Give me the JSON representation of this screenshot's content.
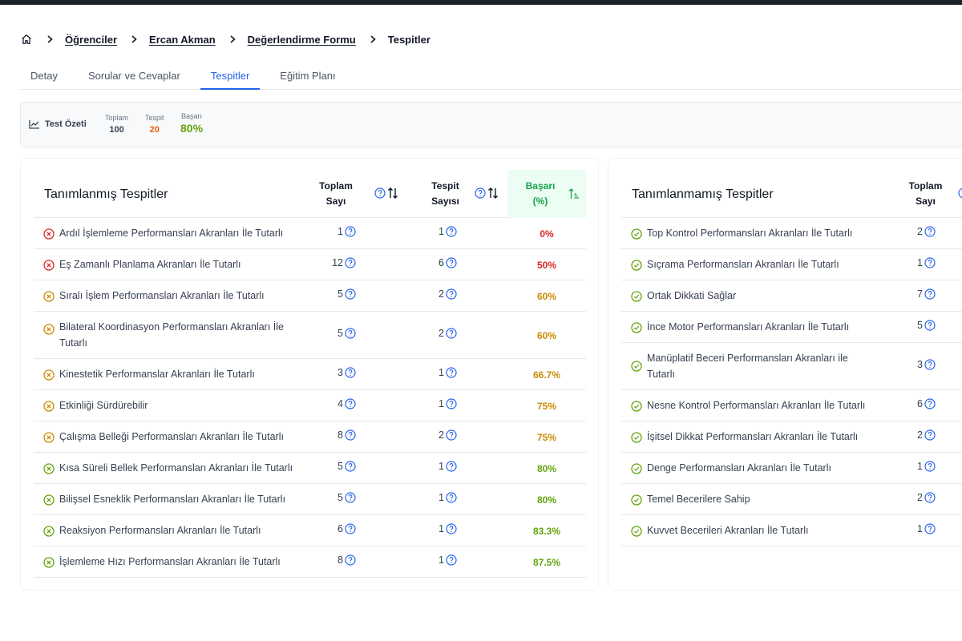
{
  "breadcrumb": {
    "items": [
      "Öğrenciler",
      "Ercan Akman",
      "Değerlendirme Formu"
    ],
    "current": "Tespitler"
  },
  "tabs": [
    {
      "label": "Detay",
      "active": false
    },
    {
      "label": "Sorular ve Cevaplar",
      "active": false
    },
    {
      "label": "Tespitler",
      "active": true
    },
    {
      "label": "Eğitim Planı",
      "active": false
    }
  ],
  "summary": {
    "title": "Test Özeti",
    "toplam_label": "Toplam",
    "toplam_value": "100",
    "tespit_label": "Tespit",
    "tespit_value": "20",
    "basari_label": "Başarı",
    "basari_value": "80%"
  },
  "defined": {
    "title": "Tanımlanmış Tespitler",
    "col_total_1": "Toplam",
    "col_total_2": "Sayı",
    "col_tespit_1": "Tespit",
    "col_tespit_2": "Sayısı",
    "col_basari_1": "Başarı",
    "col_basari_2": "(%)",
    "rows": [
      {
        "name": "Ardıl İşlemleme Performansları Akranları İle Tutarlı",
        "total": "1",
        "tespit": "1",
        "pct": "0%",
        "level": "red"
      },
      {
        "name": "Eş Zamanlı Planlama Akranları İle Tutarlı",
        "total": "12",
        "tespit": "6",
        "pct": "50%",
        "level": "red"
      },
      {
        "name": "Sıralı İşlem Performansları Akranları İle Tutarlı",
        "total": "5",
        "tespit": "2",
        "pct": "60%",
        "level": "amber"
      },
      {
        "name": "Bilateral Koordinasyon Performansları Akranları İle",
        "name2": "Tutarlı",
        "total": "5",
        "tespit": "2",
        "pct": "60%",
        "level": "amber"
      },
      {
        "name": "Kinestetik Performanslar Akranları İle Tutarlı",
        "total": "3",
        "tespit": "1",
        "pct": "66.7%",
        "level": "amber"
      },
      {
        "name": "Etkinliği Sürdürebilir",
        "total": "4",
        "tespit": "1",
        "pct": "75%",
        "level": "amber"
      },
      {
        "name": "Çalışma Belleği Performansları Akranları İle Tutarlı",
        "total": "8",
        "tespit": "2",
        "pct": "75%",
        "level": "amber"
      },
      {
        "name": "Kısa Süreli Bellek Performansları Akranları İle Tutarlı",
        "total": "5",
        "tespit": "1",
        "pct": "80%",
        "level": "green"
      },
      {
        "name": "Bilişsel Esneklik Performansları Akranları İle Tutarlı",
        "total": "5",
        "tespit": "1",
        "pct": "80%",
        "level": "green"
      },
      {
        "name": "Reaksiyon Performansları Akranları İle Tutarlı",
        "total": "6",
        "tespit": "1",
        "pct": "83.3%",
        "level": "green"
      },
      {
        "name": "İşlemleme Hızı Performansları Akranları İle Tutarlı",
        "total": "8",
        "tespit": "1",
        "pct": "87.5%",
        "level": "green"
      }
    ]
  },
  "undefined": {
    "title": "Tanımlanmamış Tespitler",
    "col_total_1": "Toplam",
    "col_total_2": "Sayı",
    "rows": [
      {
        "name": "Top Kontrol Performansları Akranları İle Tutarlı",
        "total": "2"
      },
      {
        "name": "Sıçrama Performansları Akranları İle Tutarlı",
        "total": "1"
      },
      {
        "name": "Ortak Dikkati Sağlar",
        "total": "7"
      },
      {
        "name": "İnce Motor Performansları Akranları İle Tutarlı",
        "total": "5"
      },
      {
        "name": "Manüplatif Beceri Performansları Akranları ile",
        "name2": "Tutarlı",
        "total": "3"
      },
      {
        "name": "Nesne Kontrol Performansları Akranları İle Tutarlı",
        "total": "6"
      },
      {
        "name": "İşitsel Dikkat Performansları Akranları İle Tutarlı",
        "total": "2"
      },
      {
        "name": "Denge Performansları Akranları İle Tutarlı",
        "total": "1"
      },
      {
        "name": "Temel Becerilere Sahip",
        "total": "2"
      },
      {
        "name": "Kuvvet Becerileri Akranları İle Tutarlı",
        "total": "1"
      }
    ]
  },
  "colors": {
    "red": "#dc2626",
    "amber": "#ca8a04",
    "green": "#65a30d",
    "accent": "#2563eb"
  }
}
